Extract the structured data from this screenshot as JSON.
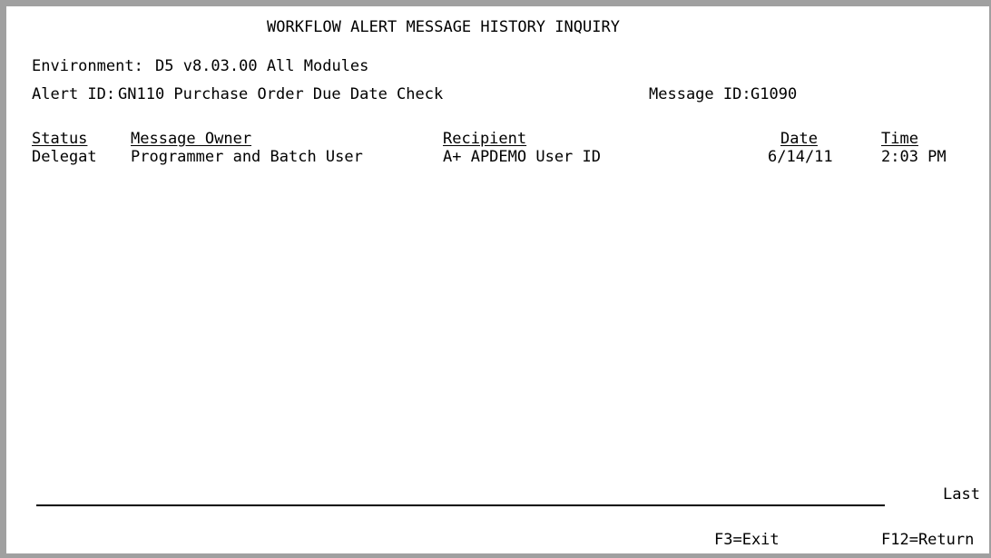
{
  "screen": {
    "title": "WORKFLOW ALERT MESSAGE HISTORY INQUIRY",
    "environment_label": "Environment:",
    "environment_value": "D5 v8.03.00 All Modules",
    "alert_id_label": "Alert ID:",
    "alert_id_value": "GN110 Purchase Order Due Date Check",
    "message_id_label": "Message ID:",
    "message_id_value": "G1090"
  },
  "table": {
    "columns": {
      "status": "Status",
      "owner": "Message Owner",
      "recipient": "Recipient",
      "date": "Date",
      "time": "Time"
    },
    "rows": [
      {
        "status": "Delegat",
        "owner": "Programmer and Batch User",
        "recipient": "A+ APDEMO User ID",
        "date": "6/14/11",
        "time": "2:03 PM"
      }
    ]
  },
  "footer": {
    "position_indicator": "Last",
    "keys": [
      {
        "label": "F3=Exit"
      },
      {
        "label": "F12=Return"
      }
    ]
  }
}
